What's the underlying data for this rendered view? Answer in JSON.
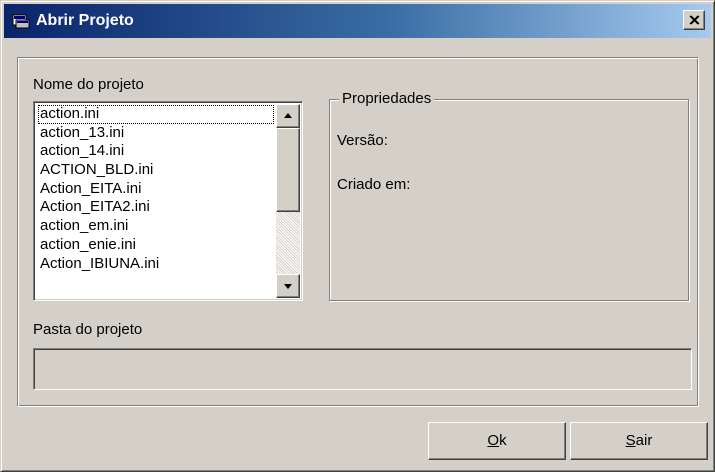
{
  "window": {
    "title": "Abrir Projeto",
    "titlebar_colors": [
      "#0a246a",
      "#a6caf0"
    ],
    "app_icon": "project-window-icon",
    "close_icon": "close-icon"
  },
  "project_list": {
    "label": "Nome do projeto",
    "items": [
      "action.ini",
      "action_13.ini",
      "action_14.ini",
      "ACTION_BLD.ini",
      "Action_EITA.ini",
      "Action_EITA2.ini",
      "action_em.ini",
      "action_enie.ini",
      "Action_IBIUNA.ini"
    ],
    "focused_item": "action.ini"
  },
  "properties": {
    "title": "Propriedades",
    "version_label": "Versão:",
    "version_value": "",
    "created_label": "Criado em:",
    "created_value": ""
  },
  "project_folder": {
    "label": "Pasta do projeto",
    "value": ""
  },
  "buttons": {
    "ok": {
      "mnemonic": "O",
      "rest": "k"
    },
    "exit": {
      "mnemonic": "S",
      "rest": "air"
    }
  }
}
